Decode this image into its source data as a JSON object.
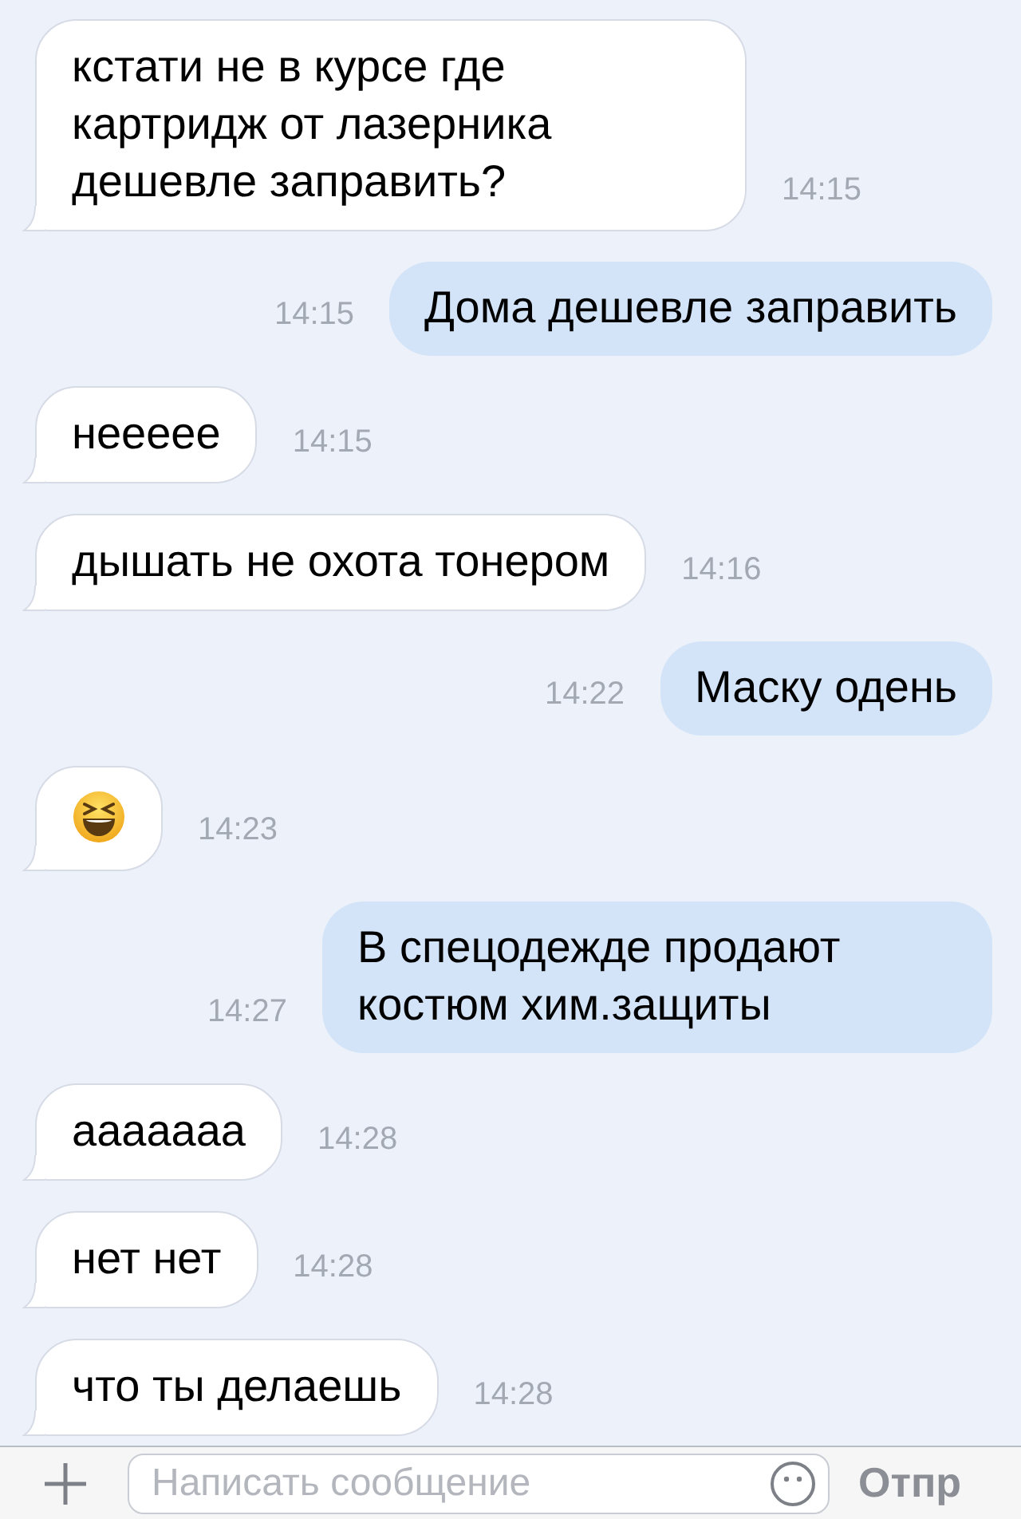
{
  "messages": [
    {
      "outgoing": false,
      "kind": "text",
      "text": "кстати не в курсе где картридж от лазерника дешевле заправить?",
      "time": "14:15"
    },
    {
      "outgoing": true,
      "kind": "text",
      "text": "Дома дешевле заправить",
      "time": "14:15"
    },
    {
      "outgoing": false,
      "kind": "text",
      "text": "неееее",
      "time": "14:15"
    },
    {
      "outgoing": false,
      "kind": "text",
      "text": "дышать не охота тонером",
      "time": "14:16"
    },
    {
      "outgoing": true,
      "kind": "text",
      "text": "Маску одень",
      "time": "14:22"
    },
    {
      "outgoing": false,
      "kind": "emoji",
      "time": "14:23"
    },
    {
      "outgoing": true,
      "kind": "text",
      "text": "В спецодежде продают костюм хим.защиты",
      "time": "14:27"
    },
    {
      "outgoing": false,
      "kind": "text",
      "text": "ааааааа",
      "time": "14:28"
    },
    {
      "outgoing": false,
      "kind": "text",
      "text": "нет нет",
      "time": "14:28"
    },
    {
      "outgoing": false,
      "kind": "text",
      "text": "что ты делаешь",
      "time": "14:28"
    }
  ],
  "composer": {
    "placeholder": "Написать сообщение",
    "send_label": "Отпр"
  }
}
